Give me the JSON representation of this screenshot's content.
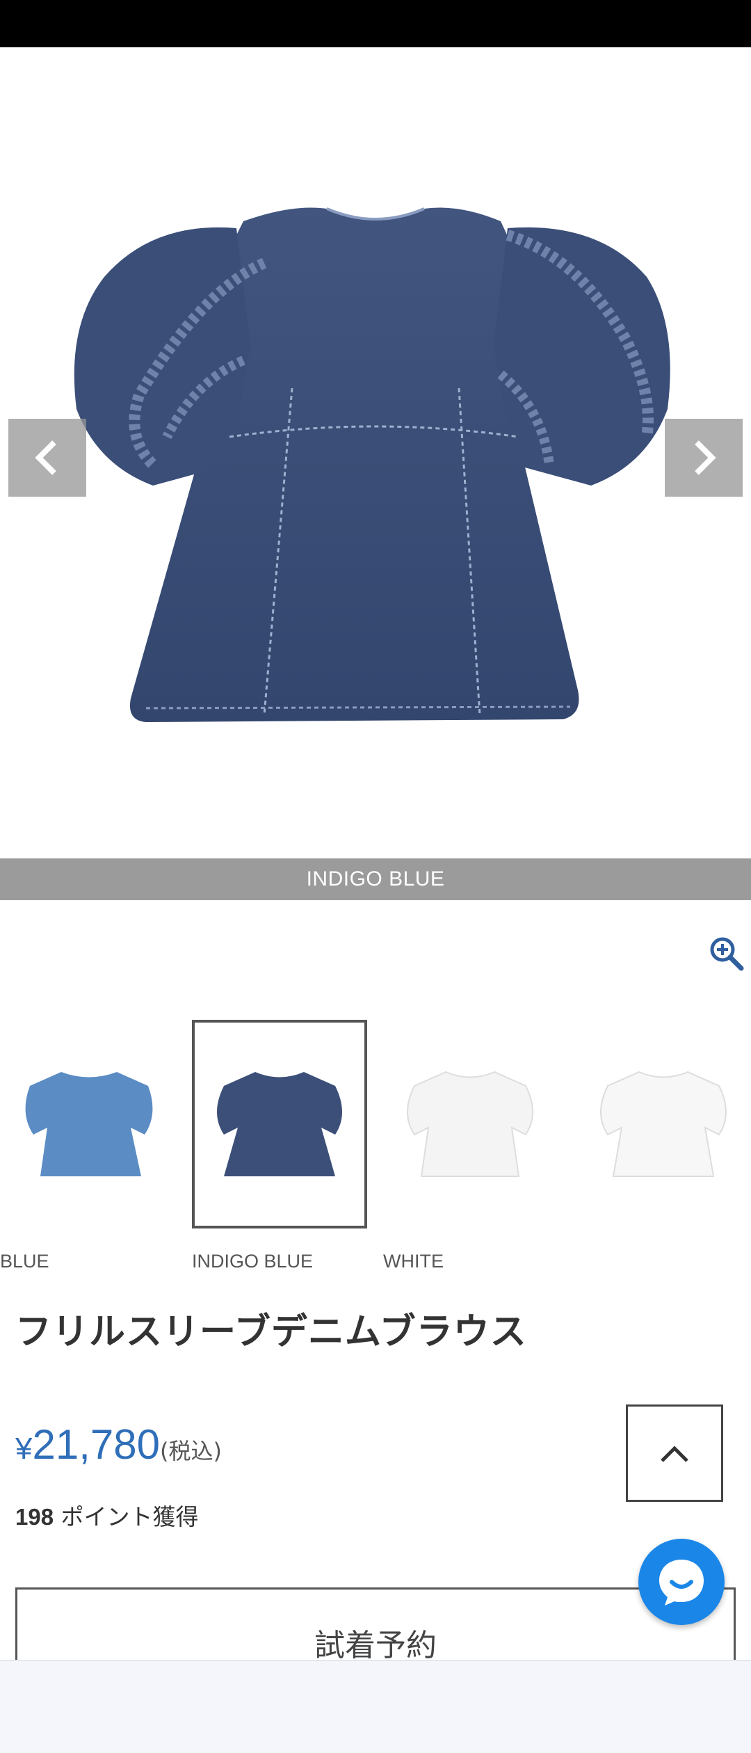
{
  "main_image": {
    "color_caption": "INDIGO BLUE",
    "prev_icon": "chevron-left-icon",
    "next_icon": "chevron-right-icon"
  },
  "zoom": {
    "icon": "zoom-in-icon"
  },
  "colors": {
    "accent_blue": "#2f6eb8",
    "denim_indigo": "#3b4f78",
    "denim_blue": "#5b8cc4",
    "chat_blue": "#1a86e8"
  },
  "thumbnails": [
    {
      "label": "BLUE",
      "selected": false
    },
    {
      "label": "INDIGO BLUE",
      "selected": true
    },
    {
      "label": "WHITE",
      "selected": false
    },
    {
      "label": "",
      "selected": false
    }
  ],
  "product": {
    "title": "フリルスリーブデニムブラウス",
    "price_symbol": "¥",
    "price_value": "21,780",
    "price_tax": "(税込)",
    "points_value": "198",
    "points_text": " ポイント獲得"
  },
  "actions": {
    "reserve_label": "試着予約",
    "scroll_top_icon": "chevron-up-icon",
    "chat_icon": "chat-bubble-icon"
  }
}
